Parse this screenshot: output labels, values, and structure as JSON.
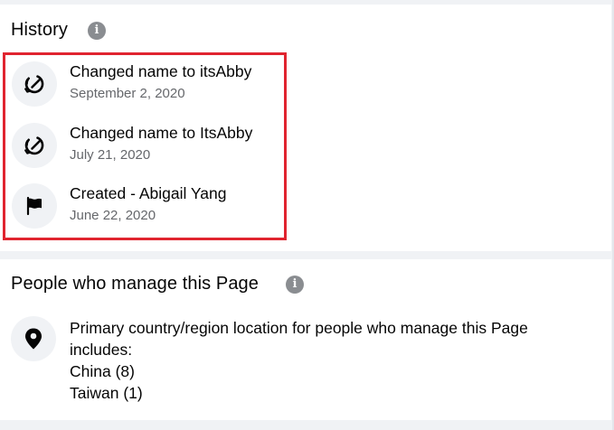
{
  "history": {
    "title": "History",
    "info_icon": "i",
    "highlight_color": "#e0242f",
    "items": [
      {
        "icon": "edit-name-icon",
        "title": "Changed name to itsAbby",
        "date": "September 2, 2020"
      },
      {
        "icon": "edit-name-icon",
        "title": "Changed name to ItsAbby",
        "date": "July 21, 2020"
      },
      {
        "icon": "flag-icon",
        "title": "Created - Abigail Yang",
        "date": "June 22, 2020"
      }
    ]
  },
  "managers": {
    "title": "People who manage this Page",
    "info_icon": "i",
    "location_icon": "location-pin-icon",
    "description_line1": "Primary country/region location for people who manage this Page",
    "description_line2": "includes:",
    "countries": [
      {
        "label": "China (8)"
      },
      {
        "label": "Taiwan (1)"
      }
    ]
  }
}
